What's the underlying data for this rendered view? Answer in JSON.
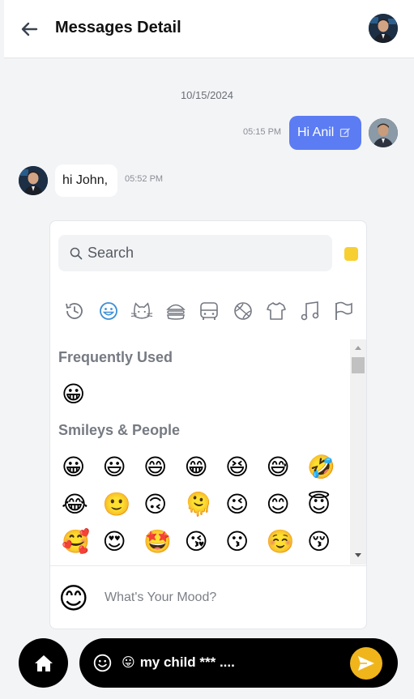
{
  "header": {
    "title": "Messages Detail",
    "back_icon": "arrow-left-icon",
    "avatar": "user-avatar"
  },
  "conversation": {
    "date": "10/15/2024",
    "messages": [
      {
        "direction": "outgoing",
        "text": "Hi Anil",
        "time": "05:15 PM",
        "icon": "edit-icon",
        "bubble_color": "#5b7cf2"
      },
      {
        "direction": "incoming",
        "text": "hi John,",
        "time": "05:52 PM",
        "bubble_color": "#ffffff"
      }
    ]
  },
  "emoji_picker": {
    "search_placeholder": "Search",
    "skin_tone_color": "#f8cf31",
    "categories": [
      "recent-icon",
      "smileys-icon",
      "animals-icon",
      "food-icon",
      "travel-icon",
      "activity-icon",
      "objects-icon",
      "symbols-icon",
      "flags-icon"
    ],
    "active_category": "smileys-icon",
    "sections": [
      {
        "title": "Frequently Used",
        "emojis": [
          "😀"
        ]
      },
      {
        "title": "Smileys & People",
        "emojis": [
          "😀",
          "😃",
          "😄",
          "😁",
          "😆",
          "😅",
          "🤣",
          "😂",
          "🙂",
          "🙃",
          "🫠",
          "😉",
          "😊",
          "😇",
          "🥰",
          "😍",
          "🤩",
          "😘",
          "😗",
          "☺️",
          "😚"
        ]
      }
    ],
    "preview": {
      "emoji": "😊",
      "text": "What's Your Mood?"
    }
  },
  "composer": {
    "inline_emoji": "😛",
    "text": "my child *** ....",
    "send_color": "#f0b51b"
  }
}
